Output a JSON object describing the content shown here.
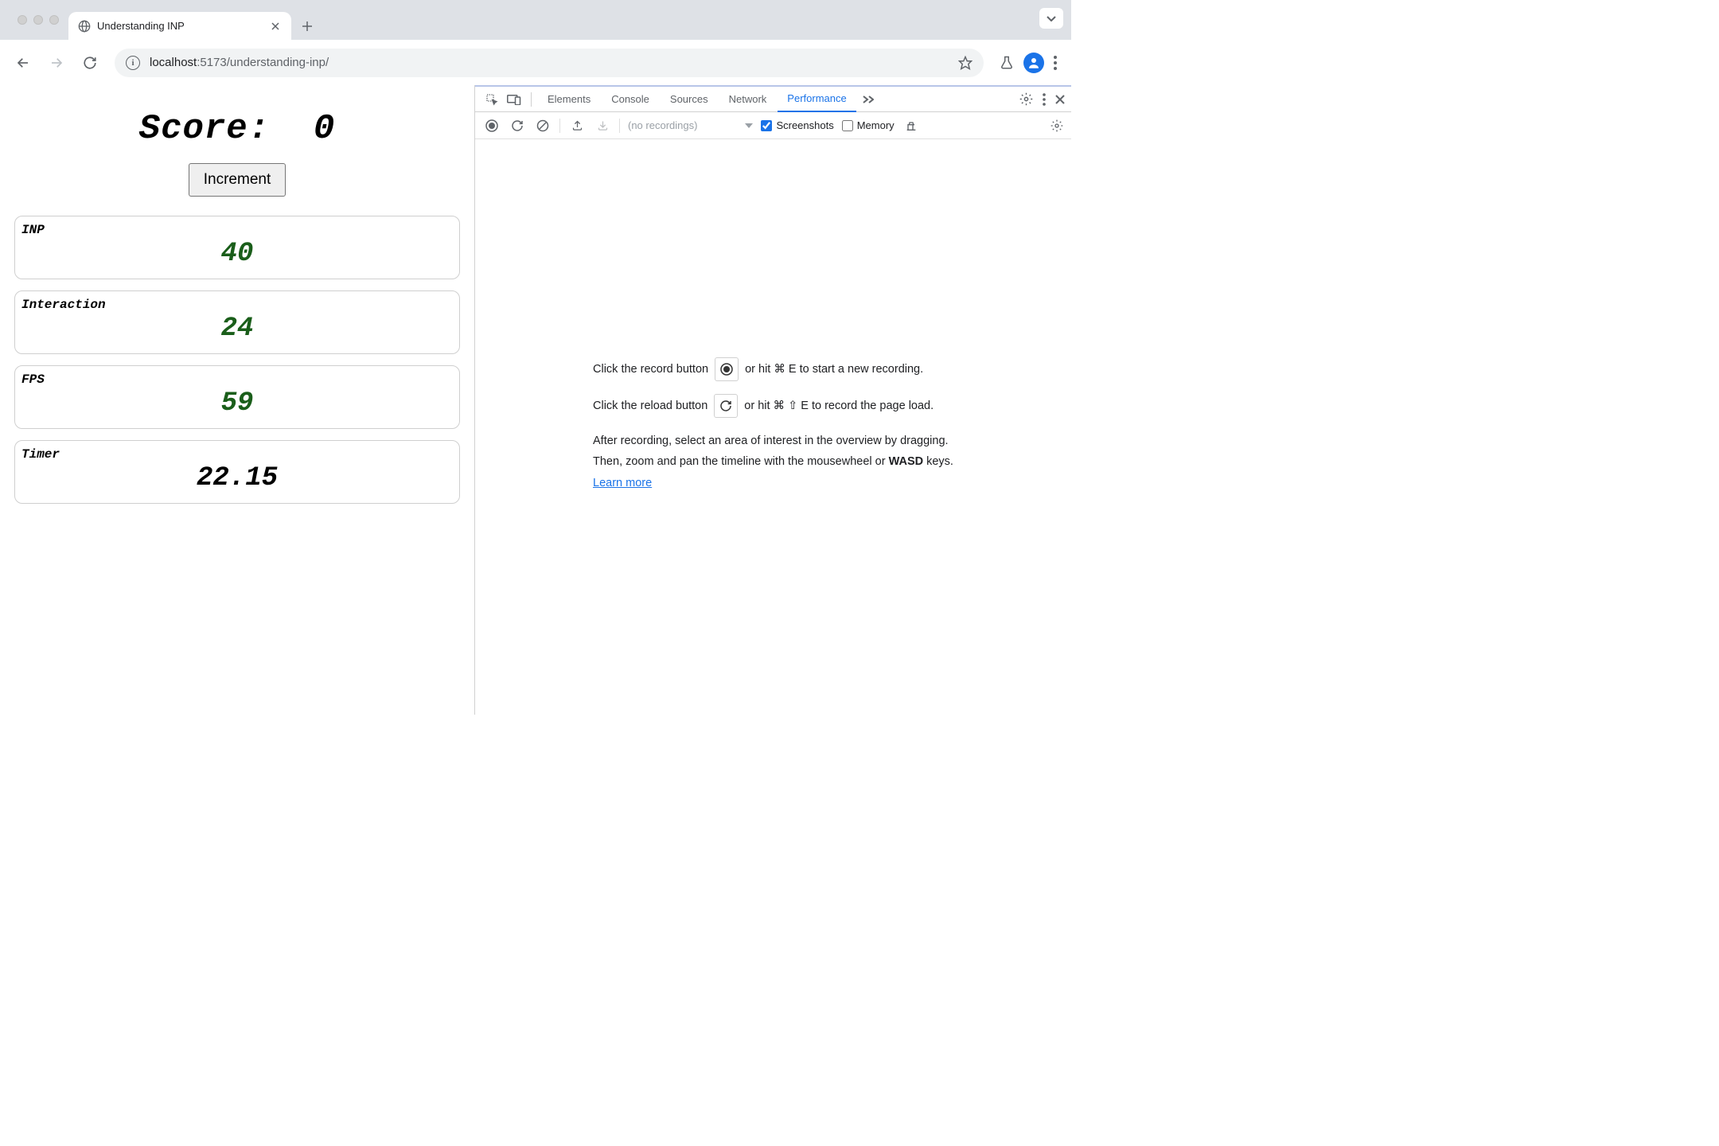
{
  "browser": {
    "tab_title": "Understanding INP",
    "url_host": "localhost",
    "url_port_path": ":5173/understanding-inp/"
  },
  "page": {
    "score_label": "Score:",
    "score_value": "0",
    "increment_label": "Increment",
    "metrics": [
      {
        "label": "INP",
        "value": "40",
        "color": "green"
      },
      {
        "label": "Interaction",
        "value": "24",
        "color": "green"
      },
      {
        "label": "FPS",
        "value": "59",
        "color": "green"
      },
      {
        "label": "Timer",
        "value": "22.15",
        "color": "black"
      }
    ]
  },
  "devtools": {
    "tabs": {
      "elements": "Elements",
      "console": "Console",
      "sources": "Sources",
      "network": "Network",
      "performance": "Performance"
    },
    "toolbar": {
      "no_recordings": "(no recordings)",
      "screenshots_label": "Screenshots",
      "memory_label": "Memory"
    },
    "instructions": {
      "record_pre": "Click the record button",
      "record_post": "or hit ⌘ E to start a new recording.",
      "reload_pre": "Click the reload button",
      "reload_post": "or hit ⌘ ⇧ E to record the page load.",
      "after1": "After recording, select an area of interest in the overview by dragging.",
      "after2": "Then, zoom and pan the timeline with the mousewheel or ",
      "wasd": "WASD",
      "after3": " keys.",
      "learn_more": "Learn more"
    }
  }
}
